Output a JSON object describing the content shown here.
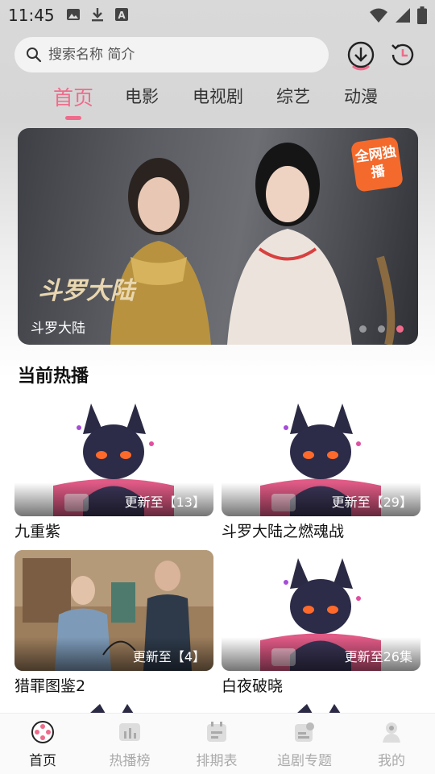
{
  "status_bar": {
    "time": "11:45",
    "icons": [
      "image-icon",
      "download-icon",
      "font-icon"
    ],
    "right_icons": [
      "wifi-icon",
      "signal-icon",
      "battery-icon"
    ]
  },
  "search": {
    "placeholder": "搜索名称 简介"
  },
  "header_buttons": [
    "download-icon",
    "history-icon"
  ],
  "category_tabs": [
    {
      "label": "首页",
      "active": true
    },
    {
      "label": "电影",
      "active": false
    },
    {
      "label": "电视剧",
      "active": false
    },
    {
      "label": "综艺",
      "active": false
    },
    {
      "label": "动漫",
      "active": false
    }
  ],
  "banner": {
    "caption": "斗罗大陆",
    "badge": "全网独播",
    "pages": 3,
    "active_page": 3
  },
  "section": {
    "title": "当前热播"
  },
  "cards": [
    {
      "title": "九重紫",
      "update": "更新至【13】",
      "art": "cat"
    },
    {
      "title": "斗罗大陆之燃魂战",
      "update": "更新至【29】",
      "art": "cat"
    },
    {
      "title": "猎罪图鉴2",
      "update": "更新至【4】",
      "art": "drama"
    },
    {
      "title": "白夜破晓",
      "update": "更新至26集",
      "art": "cat"
    }
  ],
  "bottom_nav": [
    {
      "label": "首页",
      "icon": "film-reel-icon",
      "active": true
    },
    {
      "label": "热播榜",
      "icon": "chart-icon",
      "active": false
    },
    {
      "label": "排期表",
      "icon": "calendar-icon",
      "active": false
    },
    {
      "label": "追剧专题",
      "icon": "topic-icon",
      "active": false
    },
    {
      "label": "我的",
      "icon": "user-icon",
      "active": false
    }
  ],
  "colors": {
    "accent": "#f06b8b",
    "badge": "#f46a2c"
  }
}
